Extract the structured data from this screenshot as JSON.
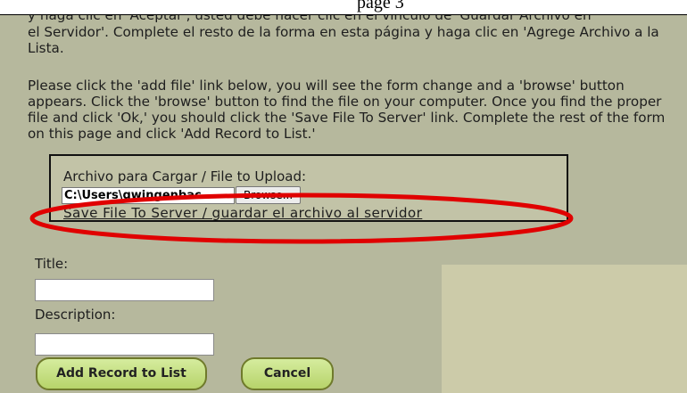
{
  "top_caption": "page 3",
  "instructions": {
    "spanish_cut_line": "y haga clic en 'Aceptar', usted debe hacer clic en el vínculo de 'Guardar Archivo en",
    "spanish": "el Servidor'. Complete el resto de la forma en esta página y haga clic en 'Agrege Archivo a la Lista.",
    "english": "Please click the 'add file' link below, you will see the form change and a 'browse' button appears. Click the 'browse' button to find the file on your computer. Once you find the proper file and click 'Ok,' you should click the 'Save File To Server' link. Complete the rest of the form on this page and click 'Add Record to List.'"
  },
  "upload": {
    "label": "Archivo para Cargar / File to Upload:",
    "file_path_value": "C:\\Users\\gwingenbac",
    "browse_label": "Browse...",
    "save_link": "Save File To Server / guardar el archivo al servidor"
  },
  "form": {
    "title_label": "Title:",
    "title_value": "",
    "description_label": "Description:",
    "description_value": ""
  },
  "buttons": {
    "add_record": "Add Record to List",
    "cancel": "Cancel"
  },
  "colors": {
    "page_background": "#b6b89d",
    "upload_box_background": "#c2c3a7",
    "button_green": "#c6e088",
    "highlight_ellipse": "#e00000"
  }
}
